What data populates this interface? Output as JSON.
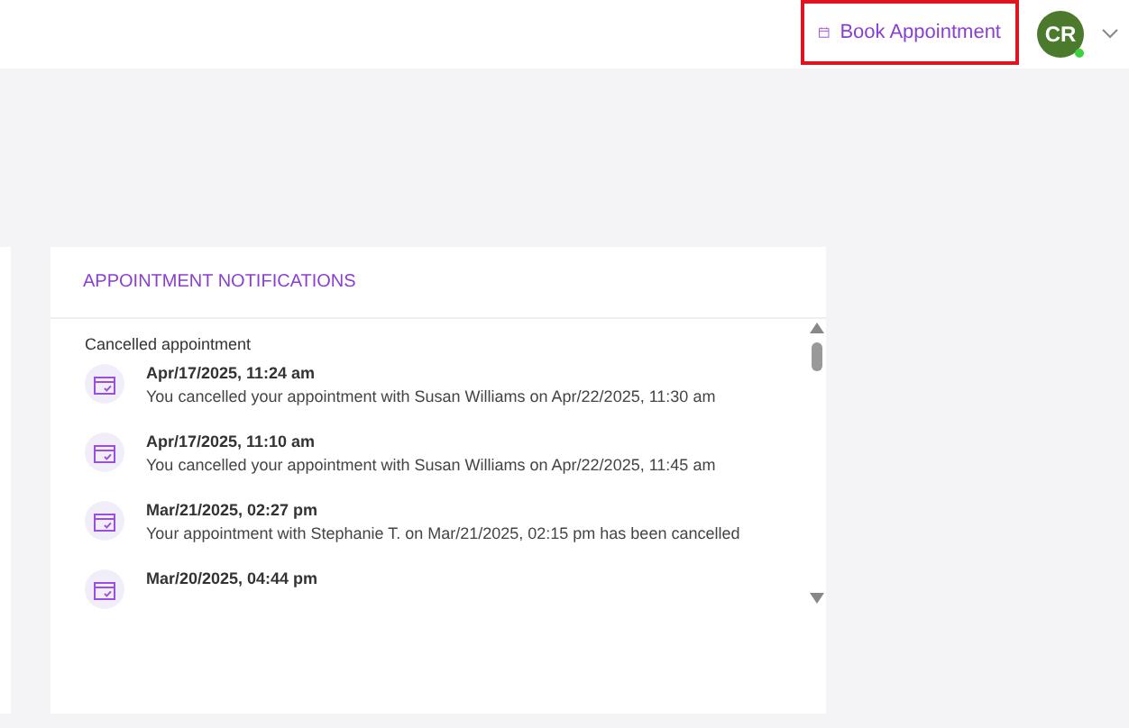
{
  "header": {
    "book_button": "Book Appointment",
    "avatar": "CR",
    "online": true
  },
  "notifications": {
    "title": "APPOINTMENT NOTIFICATIONS",
    "section": "Cancelled appointment",
    "items": [
      {
        "time": "Apr/17/2025, 11:24 am",
        "message": "You cancelled your appointment with Susan Williams on Apr/22/2025, 11:30 am"
      },
      {
        "time": "Apr/17/2025, 11:10 am",
        "message": "You cancelled your appointment with Susan Williams on Apr/22/2025, 11:45 am"
      },
      {
        "time": "Mar/21/2025, 02:27 pm",
        "message": "Your appointment with Stephanie T. on Mar/21/2025, 02:15 pm has been cancelled"
      },
      {
        "time": "Mar/20/2025, 04:44 pm"
      }
    ]
  }
}
